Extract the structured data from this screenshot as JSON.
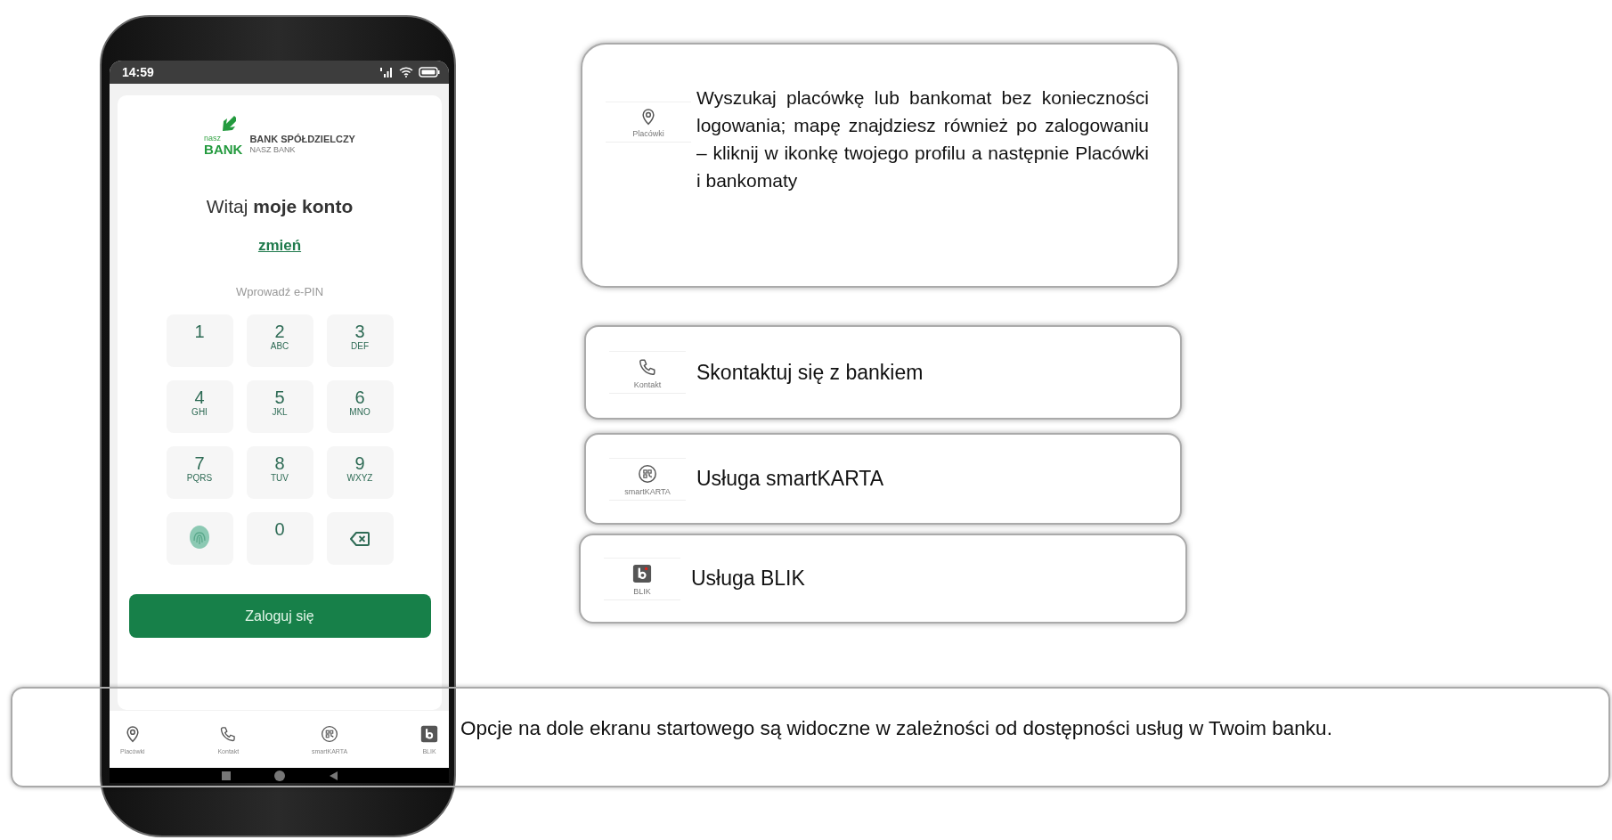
{
  "phone": {
    "status_time": "14:59",
    "logo": {
      "small": "nasz",
      "big": "BANK",
      "title": "BANK SPÓŁDZIELCZY",
      "subtitle": "NASZ BANK"
    },
    "greeting": "Witaj **moje konto**",
    "change_link": "zmień",
    "pin_prompt": "Wprowadź e-PIN",
    "keypad": [
      {
        "kind": "digit",
        "digit": "1"
      },
      {
        "kind": "digit",
        "digit": "2",
        "letters": "ABC"
      },
      {
        "kind": "digit",
        "digit": "3",
        "letters": "DEF"
      },
      {
        "kind": "digit",
        "digit": "4",
        "letters": "GHI"
      },
      {
        "kind": "digit",
        "digit": "5",
        "letters": "JKL"
      },
      {
        "kind": "digit",
        "digit": "6",
        "letters": "MNO"
      },
      {
        "kind": "digit",
        "digit": "7",
        "letters": "PQRS"
      },
      {
        "kind": "digit",
        "digit": "8",
        "letters": "TUV"
      },
      {
        "kind": "digit",
        "digit": "9",
        "letters": "WXYZ"
      },
      {
        "kind": "fingerprint"
      },
      {
        "kind": "digit",
        "digit": "0"
      },
      {
        "kind": "backspace"
      }
    ],
    "login_button": "Zaloguj się",
    "bottom_nav": [
      {
        "kind": "pin",
        "label": "Placówki"
      },
      {
        "kind": "phone",
        "label": "Kontakt"
      },
      {
        "kind": "qr",
        "label": "smartKARTA"
      },
      {
        "kind": "blik",
        "label": "BLIK"
      }
    ]
  },
  "callouts": [
    {
      "kind": "pin",
      "label": "Placówki",
      "text": "Wyszukaj placówkę lub bankomat bez konieczności logowania; mapę znajdziesz również po zalogowaniu – kliknij w ikonkę twojego profilu a następnie Placówki i bankomaty"
    },
    {
      "kind": "phone",
      "label": "Kontakt",
      "text": "Skontaktuj się z bankiem"
    },
    {
      "kind": "qr",
      "label": "smartKARTA",
      "text": "Usługa smartKARTA"
    },
    {
      "kind": "blik",
      "label": "BLIK",
      "text": "Usługa BLIK"
    }
  ],
  "note": "Opcje na dole ekranu startowego są widoczne w zależności od dostępności usług w Twoim banku."
}
